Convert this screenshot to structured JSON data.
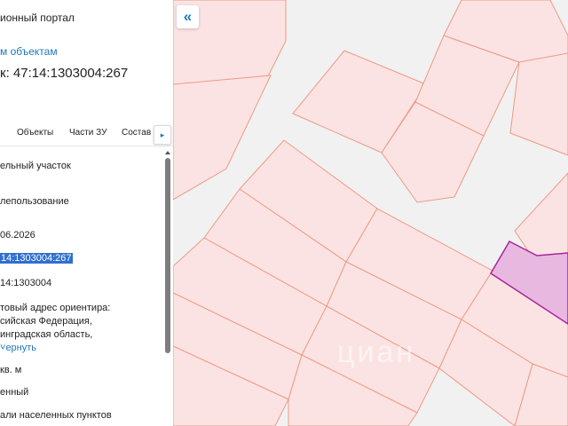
{
  "panel": {
    "title": "ионный портал",
    "back_link": "м объектам",
    "cadastral_title": "к: 47:14:1303004:267",
    "tabs": [
      {
        "label": "Объекты"
      },
      {
        "label": "Части ЗУ"
      },
      {
        "label": "Состав"
      }
    ],
    "tab_more_icon": "chevron-right-icon",
    "fields": [
      {
        "text": "ельный участок"
      },
      {
        "text": "лепользование"
      },
      {
        "text": "06.2026"
      },
      {
        "text": "14:1303004:267"
      },
      {
        "text": "14:1303004"
      },
      {
        "text": "товый адрес ориентира:"
      },
      {
        "text": "сийская Федерация,"
      },
      {
        "text": "инградская область,"
      },
      {
        "text": "кв. м"
      },
      {
        "text": "енный"
      },
      {
        "text": "али населенных пунктов"
      }
    ],
    "expand_link": "ернуть",
    "expand_icon": "chevron-down-icon"
  },
  "map": {
    "collapse_icon": "double-chevron-left-icon",
    "collapse_symbol": "«",
    "watermark": "циан",
    "parcel_fill": "#fbe3e3",
    "parcel_stroke": "#ee9a84",
    "selected_fill": "#e8b8e0",
    "selected_stroke": "#a8259a"
  }
}
